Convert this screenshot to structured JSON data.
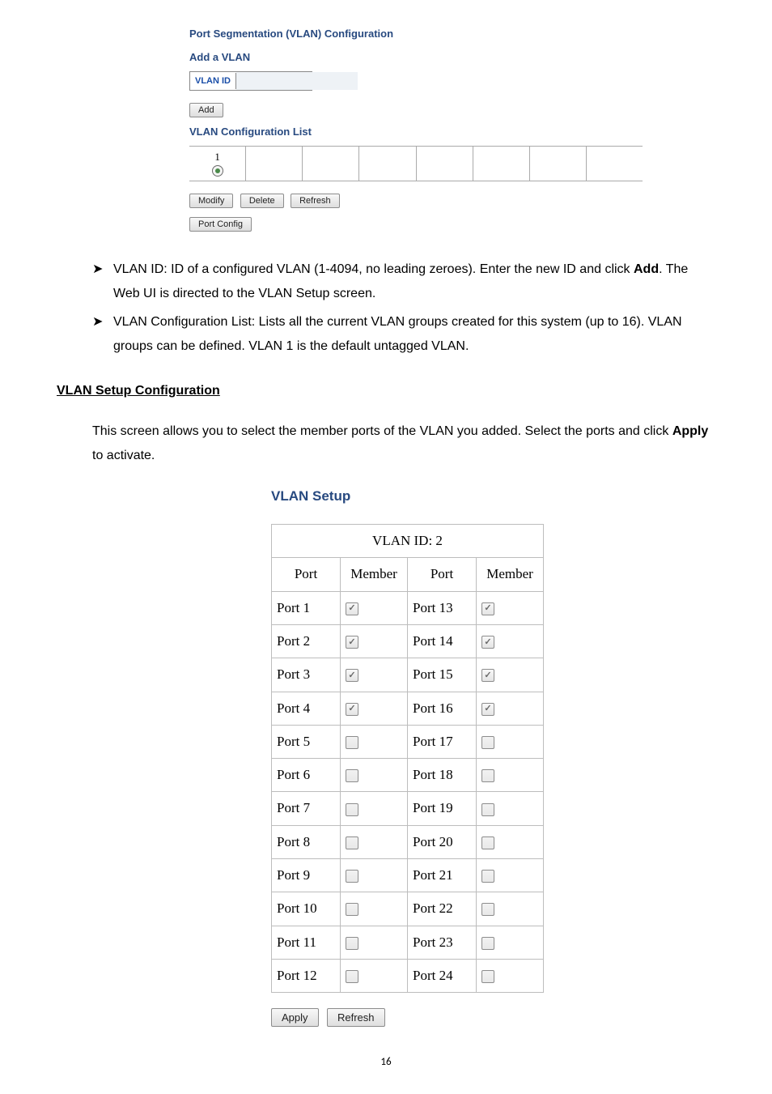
{
  "panel": {
    "title": "Port Segmentation (VLAN) Configuration",
    "add_a_vlan": "Add a VLAN",
    "vlan_id_label": "VLAN ID",
    "add_btn": "Add",
    "list_title": "VLAN Configuration List",
    "list_entry_1": "1",
    "modify_btn": "Modify",
    "delete_btn": "Delete",
    "refresh_btn": "Refresh",
    "port_config_btn": "Port Config"
  },
  "text": {
    "b1_part1": "VLAN ID: ID of a configured VLAN (1-4094, no leading zeroes). Enter the new ID and click ",
    "b1_bold": "Add",
    "b1_part2": ". The Web UI is directed to the VLAN Setup screen.",
    "b2_part1": "VLAN Configuration List: Lists all the current VLAN groups created for this system (up to 16). VLAN groups can be defined. VLAN 1 is the default untagged VLAN.",
    "section_heading": "VLAN Setup Configuration",
    "p1_part1": "This screen allows you to select the member ports of the VLAN you added. Select the ports and click ",
    "p1_bold": "Apply",
    "p1_part2": " to activate."
  },
  "setup": {
    "title": "VLAN Setup",
    "vlan_id_row": "VLAN ID: 2",
    "hdr_port": "Port",
    "hdr_member": "Member",
    "rows": [
      {
        "pL": "Port 1",
        "mL": true,
        "pR": "Port 13",
        "mR": true
      },
      {
        "pL": "Port 2",
        "mL": true,
        "pR": "Port 14",
        "mR": true
      },
      {
        "pL": "Port 3",
        "mL": true,
        "pR": "Port 15",
        "mR": true
      },
      {
        "pL": "Port 4",
        "mL": true,
        "pR": "Port 16",
        "mR": true
      },
      {
        "pL": "Port 5",
        "mL": false,
        "pR": "Port 17",
        "mR": false
      },
      {
        "pL": "Port 6",
        "mL": false,
        "pR": "Port 18",
        "mR": false
      },
      {
        "pL": "Port 7",
        "mL": false,
        "pR": "Port 19",
        "mR": false
      },
      {
        "pL": "Port 8",
        "mL": false,
        "pR": "Port 20",
        "mR": false
      },
      {
        "pL": "Port 9",
        "mL": false,
        "pR": "Port 21",
        "mR": false
      },
      {
        "pL": "Port 10",
        "mL": false,
        "pR": "Port 22",
        "mR": false
      },
      {
        "pL": "Port 11",
        "mL": false,
        "pR": "Port 23",
        "mR": false
      },
      {
        "pL": "Port 12",
        "mL": false,
        "pR": "Port 24",
        "mR": false
      }
    ],
    "apply_btn": "Apply",
    "refresh_btn": "Refresh"
  },
  "footer": {
    "page_number": "16"
  },
  "glyphs": {
    "bullet": "➤",
    "checkmark": "✓"
  }
}
